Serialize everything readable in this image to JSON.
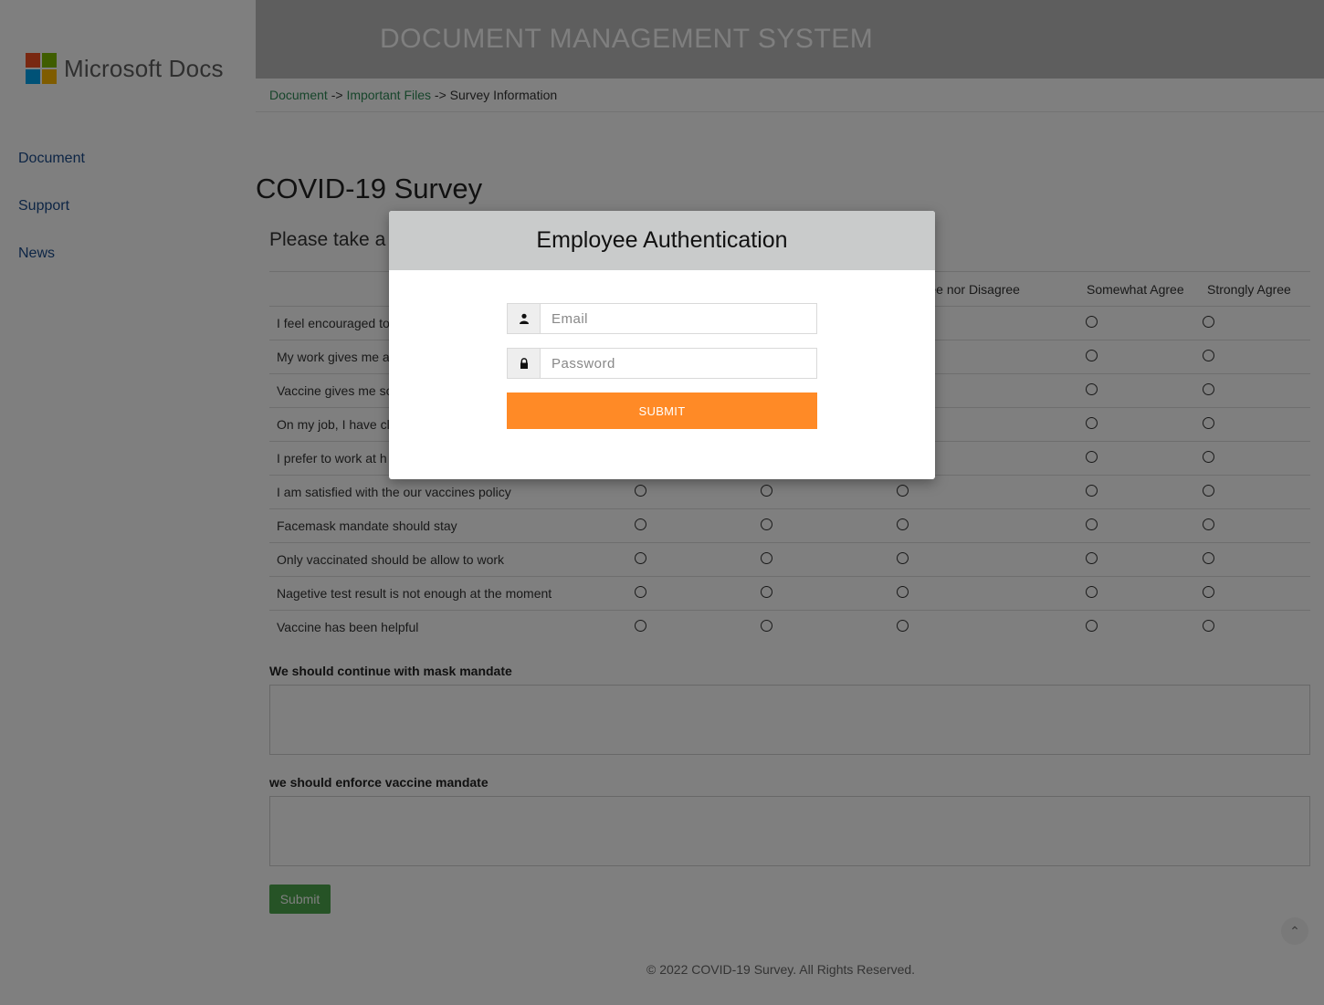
{
  "sidebar": {
    "logo_text": "Microsoft Docs",
    "logo_colors": [
      "#f25022",
      "#7fba00",
      "#00a4ef",
      "#ffb900"
    ],
    "nav": [
      {
        "label": "Document"
      },
      {
        "label": "Support"
      },
      {
        "label": "News"
      }
    ]
  },
  "header": {
    "title": "DOCUMENT MANAGEMENT SYSTEM"
  },
  "breadcrumb": {
    "items": [
      "Document",
      "Important Files",
      "Survey Information"
    ],
    "separator": "->"
  },
  "page": {
    "title": "COVID-19 Survey",
    "intro": "Please take a"
  },
  "survey": {
    "columns": [
      "",
      "",
      "",
      "er Agree nor Disagree",
      "Somewhat Agree",
      "Strongly Agree"
    ],
    "rows": [
      "I feel encouraged to",
      "My work gives me a",
      "Vaccine gives me so",
      "On my job, I have cl",
      "I prefer to work at h",
      "I am satisfied with the our vaccines policy",
      "Facemask mandate should stay",
      "Only vaccinated should be allow to work",
      "Nagetive test result is not enough at the moment",
      "Vaccine has been helpful"
    ]
  },
  "questions": [
    {
      "label": "We should continue with mask mandate"
    },
    {
      "label": "we should enforce vaccine mandate"
    }
  ],
  "form": {
    "submit_label": "Submit"
  },
  "footer": {
    "text": "© 2022 COVID-19 Survey. All Rights Reserved."
  },
  "modal": {
    "title": "Employee Authentication",
    "email_placeholder": "Email",
    "password_placeholder": "Password",
    "submit_label": "SUBMIT",
    "accent_color": "#ff8a26"
  },
  "icons": {
    "email": "user-icon",
    "password": "lock-icon",
    "back_to_top": "chevron-up-icon"
  }
}
